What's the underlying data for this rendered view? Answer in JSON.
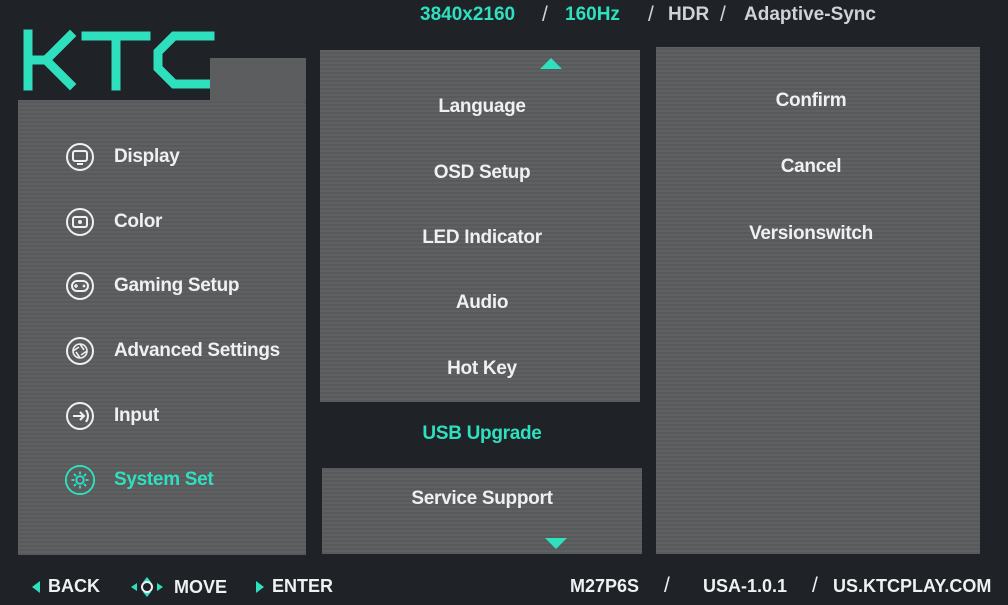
{
  "status": {
    "resolution": "3840x2160",
    "refresh": "160Hz",
    "hdr": "HDR",
    "sync": "Adaptive-Sync",
    "separator": "/"
  },
  "brand": {
    "logo_text": "KTC"
  },
  "nav": {
    "items": [
      {
        "label": "Display",
        "icon": "display-icon"
      },
      {
        "label": "Color",
        "icon": "color-icon"
      },
      {
        "label": "Gaming Setup",
        "icon": "gamepad-icon"
      },
      {
        "label": "Advanced Settings",
        "icon": "aperture-icon"
      },
      {
        "label": "Input",
        "icon": "input-icon"
      },
      {
        "label": "System Set",
        "icon": "gear-icon",
        "active": true
      }
    ]
  },
  "menu": {
    "items": [
      {
        "label": "Language"
      },
      {
        "label": "OSD Setup"
      },
      {
        "label": "LED Indicator"
      },
      {
        "label": "Audio"
      },
      {
        "label": "Hot Key"
      },
      {
        "label": "USB Upgrade",
        "selected": true
      },
      {
        "label": "Service Support"
      }
    ]
  },
  "submenu": {
    "items": [
      {
        "label": "Confirm"
      },
      {
        "label": "Cancel"
      },
      {
        "label": "Versionswitch"
      }
    ]
  },
  "footer": {
    "back_label": "BACK",
    "move_label": "MOVE",
    "enter_label": "ENTER",
    "model": "M27P6S",
    "firmware": "USA-1.0.1",
    "website": "US.KTCPLAY.COM",
    "separator": "/"
  },
  "colors": {
    "accent": "#2fe0bf",
    "panel": "#5b5d5f",
    "background": "#1f2226",
    "text": "#eef0f1"
  }
}
